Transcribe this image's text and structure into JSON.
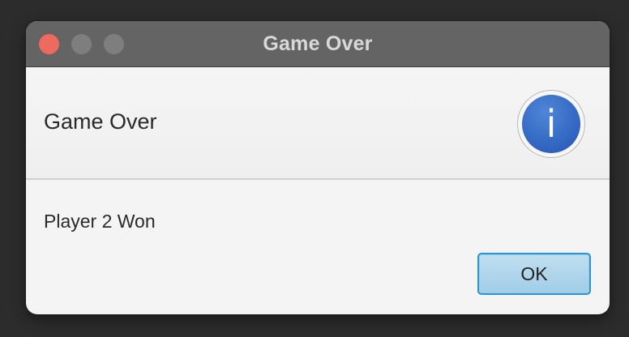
{
  "window": {
    "title": "Game Over"
  },
  "dialog": {
    "header_text": "Game Over",
    "info_icon_glyph": "i",
    "content_text": "Player 2 Won",
    "ok_label": "OK"
  },
  "icons": {
    "close": "close-traffic-light",
    "minimize": "minimize-traffic-light",
    "zoom": "zoom-traffic-light",
    "info": "information-icon"
  },
  "colors": {
    "close_button": "#ec6a5e",
    "inactive_button": "#7e7e7e",
    "titlebar": "#636463",
    "info_icon": "#2f63c0",
    "ok_button_focus": "#2c93d6"
  }
}
